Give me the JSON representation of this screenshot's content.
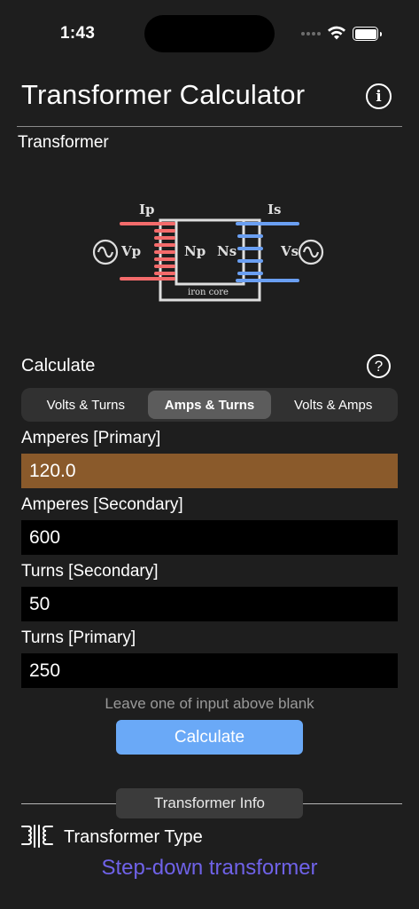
{
  "status_bar": {
    "time": "1:43"
  },
  "header": {
    "title": "Transformer Calculator"
  },
  "section": {
    "label": "Transformer"
  },
  "diagram": {
    "labels": {
      "ip": "Ip",
      "is": "Is",
      "vp": "Vp",
      "vs": "Vs",
      "np": "Np",
      "ns": "Ns",
      "core": "iron core"
    },
    "colors": {
      "primary": "#f46b6b",
      "secondary": "#6a9ff2",
      "core": "#dedede"
    }
  },
  "calculate": {
    "label": "Calculate",
    "help_icon": "?",
    "tabs": [
      {
        "label": "Volts & Turns"
      },
      {
        "label": "Amps & Turns",
        "selected": true
      },
      {
        "label": "Volts & Amps"
      }
    ],
    "fields": [
      {
        "label": "Amperes [Primary]",
        "value": "120.0"
      },
      {
        "label": "Amperes [Secondary]",
        "value": "600"
      },
      {
        "label": "Turns [Secondary]",
        "value": "50"
      },
      {
        "label": "Turns [Primary]",
        "value": "250"
      }
    ],
    "hint": "Leave one of input above blank",
    "button_label": "Calculate"
  },
  "info": {
    "badge": "Transformer Info",
    "type_label": "Transformer Type",
    "type_value": "Step-down transformer"
  },
  "colors": {
    "accent_button": "#6aa9f7",
    "focused_field": "#8a5a2b",
    "result_text": "#6f62e8"
  }
}
